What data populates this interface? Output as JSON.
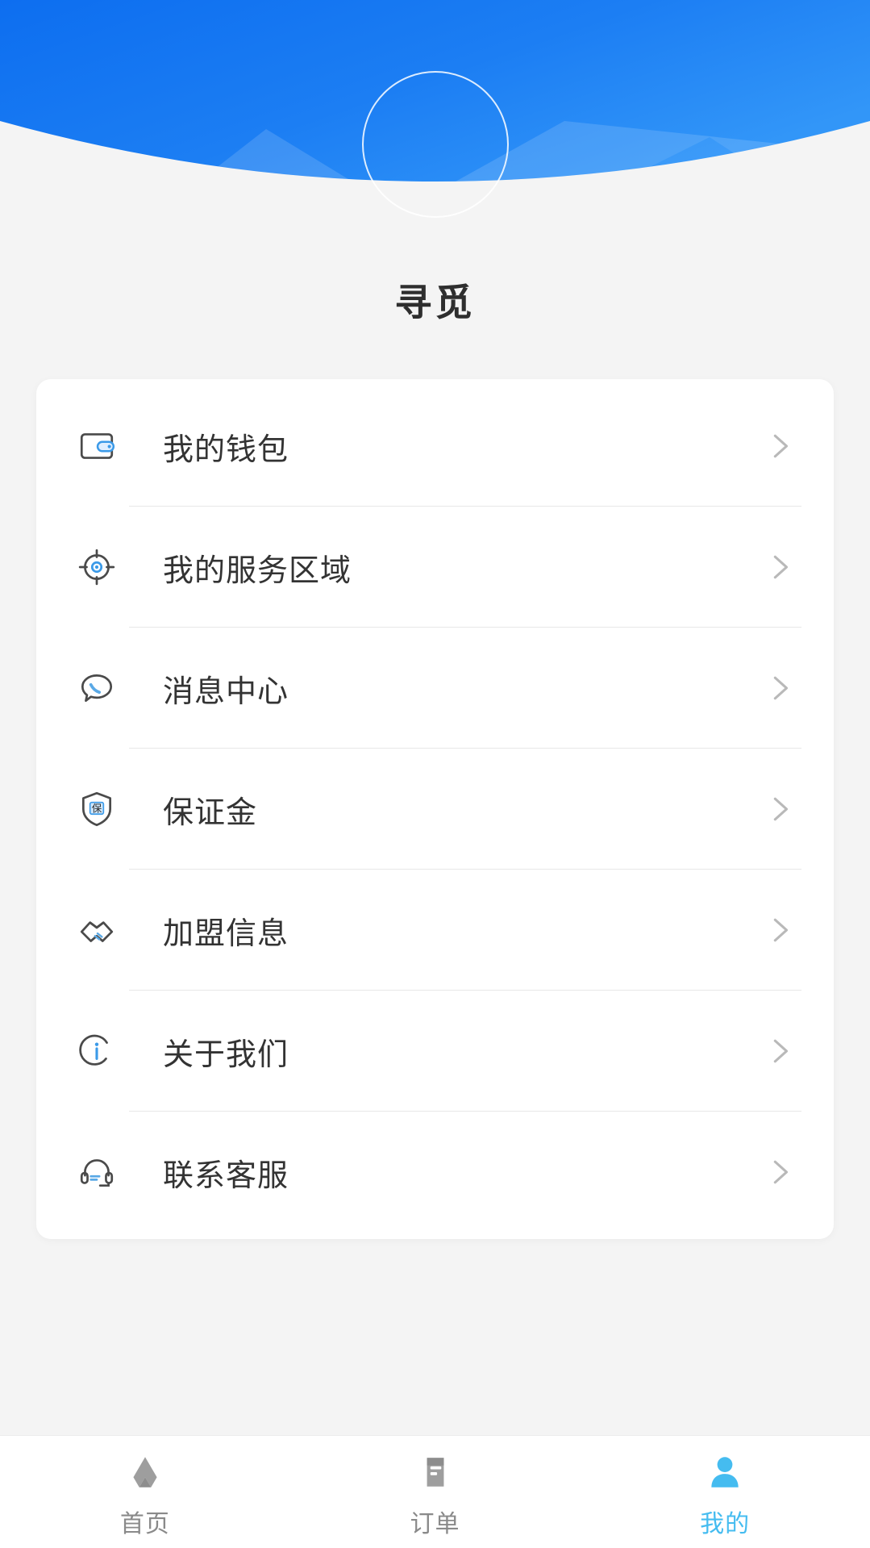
{
  "header": {
    "title": "寻觅",
    "avatar_icon": "avatar-ring",
    "colors": {
      "gradient_start": "#0d6ef0",
      "gradient_end": "#2f93f7",
      "ring_stroke": "#ffffff"
    }
  },
  "menu": {
    "items": [
      {
        "label": "我的钱包",
        "icon": "wallet-icon",
        "chevron": "chevron-right-icon"
      },
      {
        "label": "我的服务区域",
        "icon": "target-icon",
        "chevron": "chevron-right-icon"
      },
      {
        "label": "消息中心",
        "icon": "message-icon",
        "chevron": "chevron-right-icon"
      },
      {
        "label": "保证金",
        "icon": "shield-icon",
        "chevron": "chevron-right-icon"
      },
      {
        "label": "加盟信息",
        "icon": "handshake-icon",
        "chevron": "chevron-right-icon"
      },
      {
        "label": "关于我们",
        "icon": "info-icon",
        "chevron": "chevron-right-icon"
      },
      {
        "label": "联系客服",
        "icon": "headset-icon",
        "chevron": "chevron-right-icon"
      }
    ]
  },
  "bottom_nav": {
    "active_color": "#45bcf0",
    "inactive_color": "#8a8a8a",
    "items": [
      {
        "label": "首页",
        "icon": "home-icon",
        "active": false
      },
      {
        "label": "订单",
        "icon": "orders-icon",
        "active": false
      },
      {
        "label": "我的",
        "icon": "person-icon",
        "active": true
      }
    ]
  }
}
